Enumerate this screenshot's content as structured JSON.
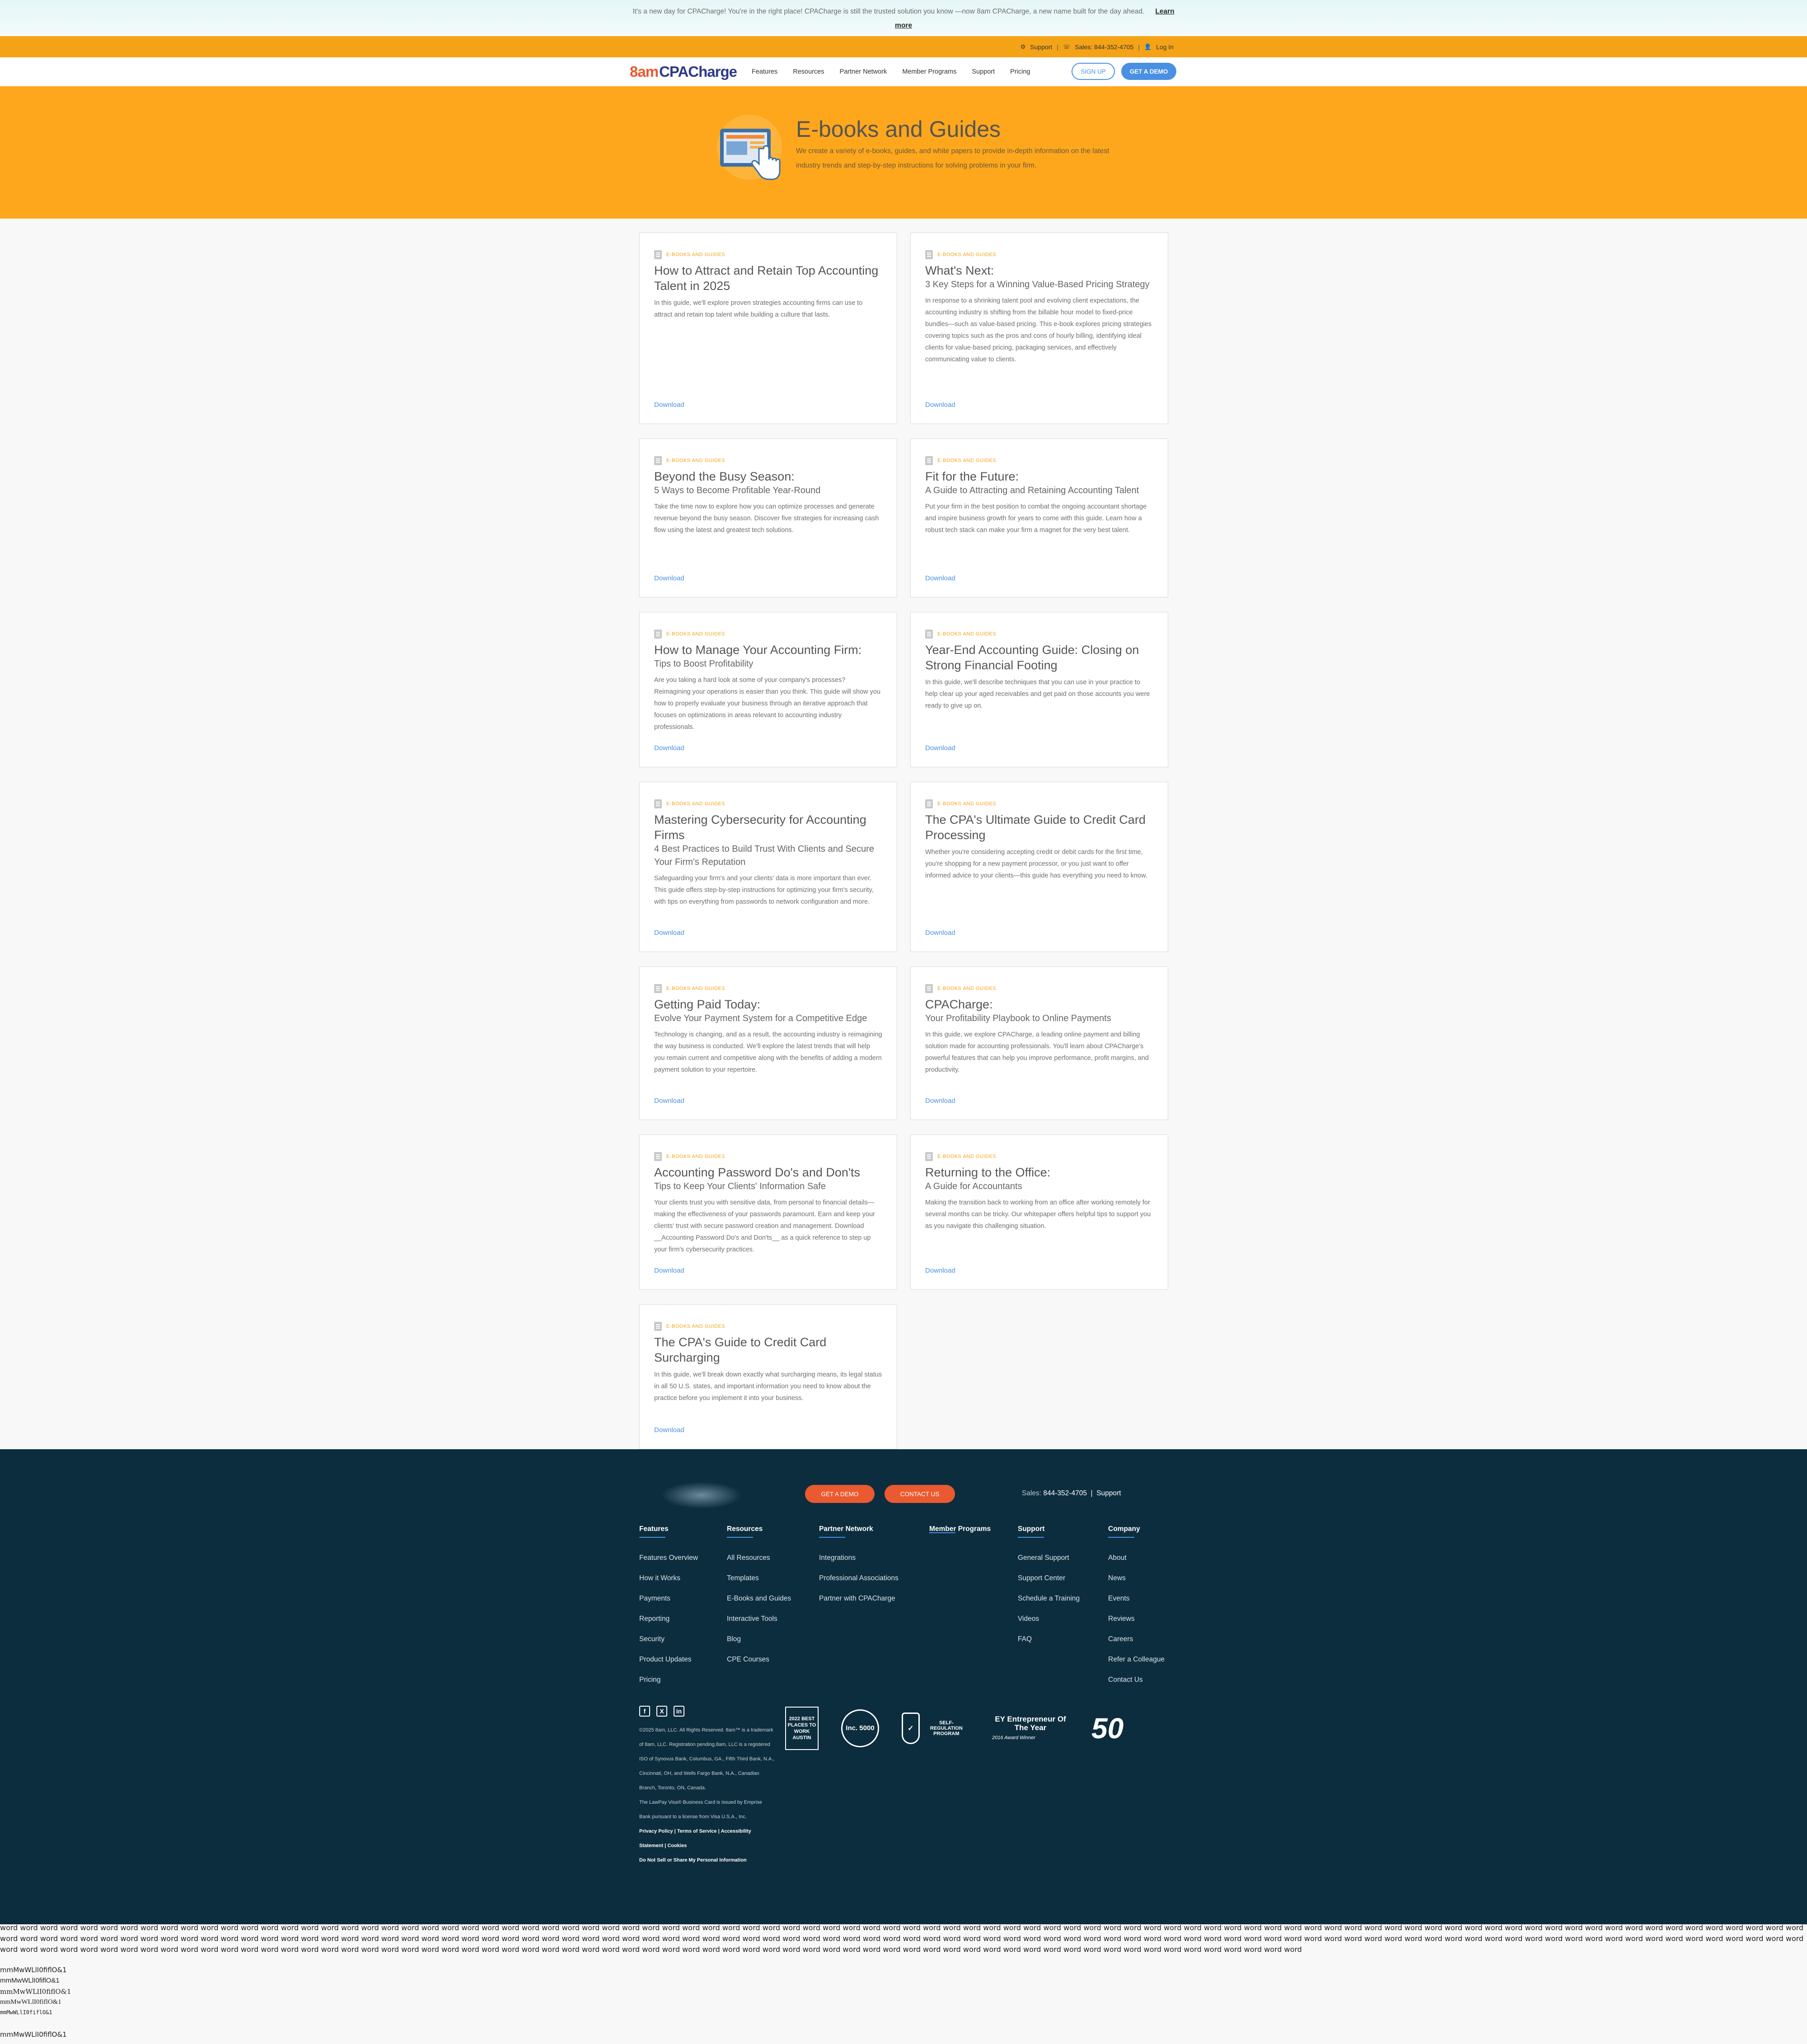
{
  "announcement": {
    "text": "It's a new day for CPACharge! You're in the right place! CPACharge is still the trusted solution you know —now 8am CPACharge, a new name built for the day ahead.",
    "link": "Learn more"
  },
  "utility": {
    "support": "Support",
    "sales": "Sales: 844-352-4705",
    "login": "Log In"
  },
  "nav": {
    "logo_part1": "8am",
    "logo_part2": "CPACharge",
    "items": [
      "Features",
      "Resources",
      "Partner Network",
      "Member Programs",
      "Support",
      "Pricing"
    ],
    "signup": "SIGN UP",
    "demo": "GET A DEMO"
  },
  "hero": {
    "title": "E-books and Guides",
    "description": "We create a variety of e-books, guides, and white papers to provide in-depth information on the latest industry trends and step-by-step instructions for solving problems in your firm."
  },
  "card_tag": "E-BOOKS AND GUIDES",
  "download_label": "Download",
  "cards": [
    {
      "title": "How to Attract and Retain Top Accounting Talent in 2025",
      "subtitle": "",
      "desc": "In this guide, we'll explore proven strategies accounting firms can use to attract and retain top talent while building a culture that lasts."
    },
    {
      "title": "What's Next:",
      "subtitle": "3 Key Steps for a Winning Value-Based Pricing Strategy",
      "desc": "In response to a shrinking talent pool and evolving client expectations, the accounting industry is shifting from the billable hour model to fixed-price bundles—such as value-based pricing. This e-book explores pricing strategies covering topics such as the pros and cons of hourly billing, identifying ideal clients for value-based pricing, packaging services, and effectively communicating value to clients."
    },
    {
      "title": "Beyond the Busy Season:",
      "subtitle": "5 Ways to Become Profitable Year-Round",
      "desc": "Take the time now to explore how you can optimize processes and generate revenue beyond the busy season. Discover five strategies for increasing cash flow using the latest and greatest tech solutions."
    },
    {
      "title": "Fit for the Future:",
      "subtitle": "A Guide to Attracting and Retaining Accounting Talent",
      "desc": "Put your firm in the best position to combat the ongoing accountant shortage and inspire business growth for years to come with this guide. Learn how a robust tech stack can make your firm a magnet for the very best talent."
    },
    {
      "title": "How to Manage Your Accounting Firm:",
      "subtitle": "Tips to Boost Profitability",
      "desc": "Are you taking a hard look at some of your company's processes? Reimagining your operations is easier than you think. This guide will show you how to properly evaluate your business through an iterative approach that focuses on optimizations in areas relevant to accounting industry professionals."
    },
    {
      "title": "Year-End Accounting Guide: Closing on Strong Financial Footing",
      "subtitle": "",
      "desc": "In this guide, we'll describe techniques that you can use in your practice to help clear up your aged receivables and get paid on those accounts you were ready to give up on."
    },
    {
      "title": "Mastering Cybersecurity for Accounting Firms",
      "subtitle": "4 Best Practices to Build Trust With Clients and Secure Your Firm's Reputation",
      "desc": "Safeguarding your firm's and your clients' data is more important than ever. This guide offers step-by-step instructions for optimizing your firm's security, with tips on everything from passwords to network configuration and more."
    },
    {
      "title": "The CPA's Ultimate Guide to Credit Card Processing",
      "subtitle": "",
      "desc": "Whether you're considering accepting credit or debit cards for the first time, you're shopping for a new payment processor, or you just want to offer informed advice to your clients—this guide has everything you need to know."
    },
    {
      "title": "Getting Paid Today:",
      "subtitle": "Evolve Your Payment System for a Competitive Edge",
      "desc": "Technology is changing, and as a result, the accounting industry is reimagining the way business is conducted. We'll explore the latest trends that will help you remain current and competitive along with the benefits of adding a modern payment solution to your repertoire."
    },
    {
      "title": "CPACharge:",
      "subtitle": "Your Profitability Playbook to Online Payments",
      "desc": "In this guide, we explore CPACharge, a leading online payment and billing solution made for accounting professionals. You'll learn about CPACharge's powerful features that can help you improve performance, profit margins, and productivity."
    },
    {
      "title": "Accounting Password Do's and Don'ts",
      "subtitle": "Tips to Keep Your Clients' Information Safe",
      "desc": "Your clients trust you with sensitive data, from personal to financial details—making the effectiveness of your passwords paramount. Earn and keep your clients' trust with secure password creation and management. Download __Accounting Password Do's and Don'ts__ as a quick reference to step up your firm's cybersecurity practices."
    },
    {
      "title": "Returning to the Office:",
      "subtitle": "A Guide for Accountants",
      "desc": "Making the transition back to working from an office after working remotely for several months can be tricky. Our whitepaper offers helpful tips to support you as you navigate this challenging situation."
    },
    {
      "title": "The CPA's Guide to Credit Card Surcharging",
      "subtitle": "",
      "desc": "In this guide, we'll break down exactly what surcharging means, its legal status in all 50 U.S. states, and important information you need to know about the practice before you implement it into your business."
    }
  ],
  "footer": {
    "demo": "GET A DEMO",
    "contact": "CONTACT US",
    "sales_label": "Sales:",
    "sales_number": "844-352-4705",
    "support": "Support",
    "columns": [
      {
        "title": "Features",
        "items": [
          "Features Overview",
          "How it Works",
          "Payments",
          "Reporting",
          "Security",
          "Product Updates",
          "Pricing"
        ]
      },
      {
        "title": "Resources",
        "items": [
          "All Resources",
          "Templates",
          "E-Books and Guides",
          "Interactive Tools",
          "Blog",
          "CPE Courses"
        ]
      },
      {
        "title": "Partner Network",
        "items": [
          "Integrations",
          "Professional Associations",
          "Partner with CPACharge"
        ]
      },
      {
        "title": "Member Programs",
        "items": []
      },
      {
        "title": "Support",
        "items": [
          "General Support",
          "Support Center",
          "Schedule a Training",
          "Videos",
          "FAQ"
        ]
      },
      {
        "title": "Company",
        "items": [
          "About",
          "News",
          "Events",
          "Reviews",
          "Careers",
          "Refer a Colleague",
          "Contact Us"
        ]
      }
    ],
    "legal": "©2025 8am, LLC. All Rights Reserved. 8am™ is a trademark of 8am, LLC. Registration pending.8am, LLC is a registered ISO of Synovus Bank, Columbus, GA., Fifth Third Bank, N.A., Cincinnati, OH, and Wells Fargo Bank, N.A., Canadian Branch, Toronto, ON, Canada.",
    "legal2": "The LawPay Visa® Business Card is issued by Emprise Bank pursuant to a license from Visa U.S.A., Inc.",
    "links": [
      "Privacy Policy",
      "Terms of Service",
      "Accessibility Statement",
      "Cookies",
      "Do Not Sell or Share My Personal Information"
    ],
    "badges": {
      "bestplaces": "2022 BEST PLACES TO WORK AUSTIN",
      "inc": "Inc. 5000",
      "eloa": "SELF-REGULATION PROGRAM",
      "ey_title": "EY Entrepreneur Of The Year",
      "ey_sub": "2016 Award Winner",
      "fifty": "50"
    }
  },
  "debug": {
    "words": "word word word word word word word word word word word word word word word word word word word word word word word word word word word word word word word word word word word word word word word word word word word word word word word word word word word word word word word word word word word word word word word word word word word word word word word word word word word word word word word word word word word word word word word word word word word word word word word word word word word word word word word word word word word word word word word word word word word word word word word word word word word word word word word word word word word word word word word word word word word word word word word word word word word word word word word word word word word word word word word word word word word word word word word word word word word word word word word word word word word word word word word word word word word word word word word word word word word word word word word word word word word word word word word word word word word word word word word word word word word word word word word word word word word word word word word word word word word word word word word word word word word word word",
    "samples": [
      "mmMwWLlI0fiflO&1",
      "mmMwWLlI0fiflO&1",
      "mmMwWLlI0fiflO&1",
      "mmMwWLlI0fiflO&1",
      "mmMwWLlI0fiflO&1",
      "mmMwWLlI0fiflO&1"
    ]
  }
}
